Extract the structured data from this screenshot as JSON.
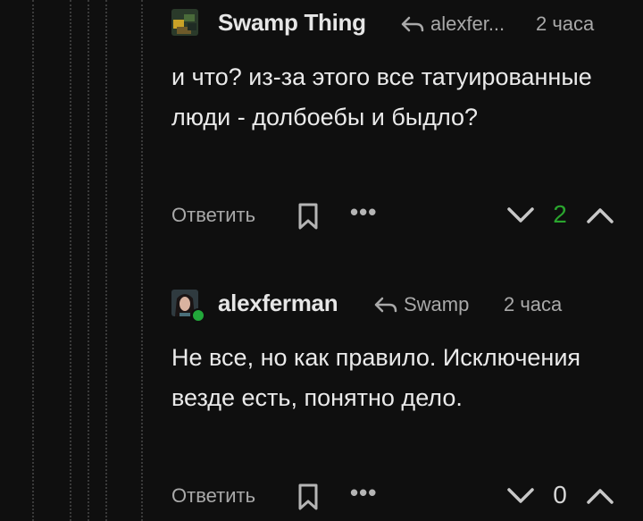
{
  "colors": {
    "background": "#0f0f0f",
    "text": "#e6e6e6",
    "muted": "#a9a9a9",
    "score_positive": "#2aa52e",
    "score_neutral": "#d6d6d6",
    "online": "#22a83a"
  },
  "comments": [
    {
      "author": "Swamp Thing",
      "reply_to": "alexfer...",
      "time": "2 часа",
      "text": "и что? из-за этого все татуированные люди - долбоебы и быдло?",
      "reply_label": "Ответить",
      "score": "2",
      "icons": {
        "reply": "reply-arrow-icon",
        "bookmark": "bookmark-icon",
        "more": "more-dots-icon",
        "down": "chevron-down-icon",
        "up": "chevron-up-icon"
      }
    },
    {
      "author": "alexferman",
      "reply_to": "Swamp",
      "time": "2 часа",
      "text": "Не все, но как правило. Исключения везде есть, понятно дело.",
      "reply_label": "Ответить",
      "score": "0",
      "online": true,
      "icons": {
        "reply": "reply-arrow-icon",
        "bookmark": "bookmark-icon",
        "more": "more-dots-icon",
        "down": "chevron-down-icon",
        "up": "chevron-up-icon"
      }
    }
  ]
}
